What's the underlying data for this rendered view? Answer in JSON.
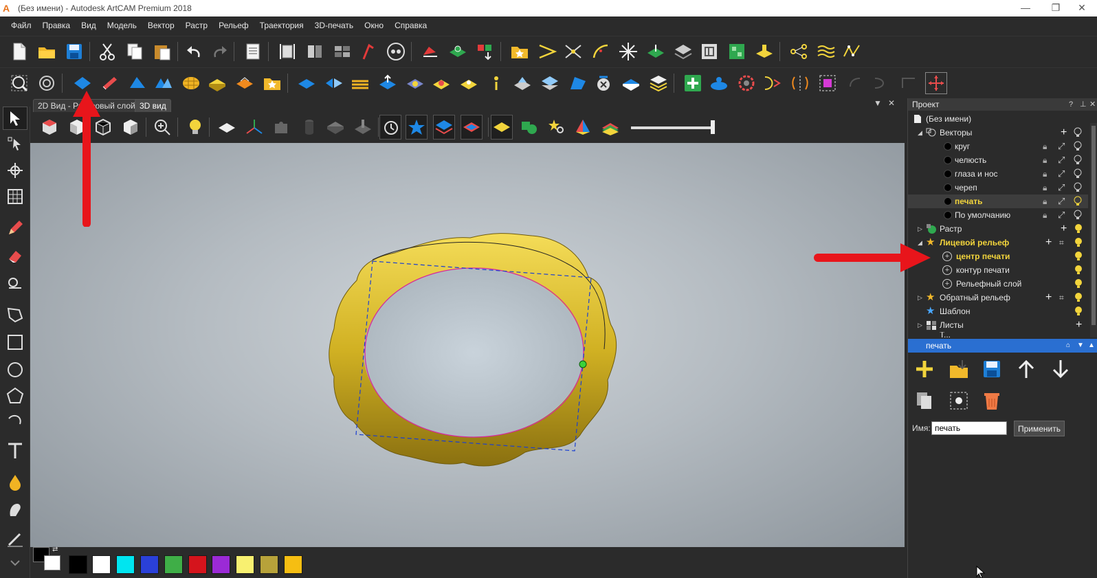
{
  "window": {
    "title": "(Без имени) - Autodesk ArtCAM Premium 2018",
    "app_icon": "A",
    "min_glyph": "—",
    "max_glyph": "❐",
    "close_glyph": "✕"
  },
  "menu": [
    "Файл",
    "Правка",
    "Вид",
    "Модель",
    "Вектор",
    "Растр",
    "Рельеф",
    "Траектория",
    "3D-печать",
    "Окно",
    "Справка"
  ],
  "tabs": {
    "tab1": "2D Вид - Растровый слой",
    "tab2": "3D вид",
    "pin": "▼",
    "close": "✕"
  },
  "project": {
    "title": "Проект",
    "help": "?",
    "pin": "⊥",
    "close": "✕",
    "root": "(Без имени)",
    "vectors": "Векторы",
    "vector_layers": [
      "круг",
      "челюсть",
      "глаза и нос",
      "череп",
      "печать",
      "По умолчанию"
    ],
    "raster": "Растр",
    "face_relief": "Лицевой рельеф",
    "relief_layers": [
      "центр печати",
      "контур печати",
      "Рельефный слой"
    ],
    "back_relief": "Обратный рельеф",
    "template": "Шаблон",
    "sheets": "Листы",
    "cut": "Т..."
  },
  "layer_panel": {
    "title": "печать",
    "name_label": "Имя:",
    "name_value": "печать",
    "apply": "Применить"
  },
  "colors": {
    "accent": "#2a6fd1",
    "highlight": "#f2d43c",
    "arrow": "#e8151b",
    "ring": "#d6b82a"
  },
  "palette": [
    "#000000",
    "#ffffff",
    "#00e5f0",
    "#2a40d8",
    "#3fae47",
    "#d5141c",
    "#9b2ad6",
    "#f8f070",
    "#b7a23a",
    "#f6be12"
  ]
}
